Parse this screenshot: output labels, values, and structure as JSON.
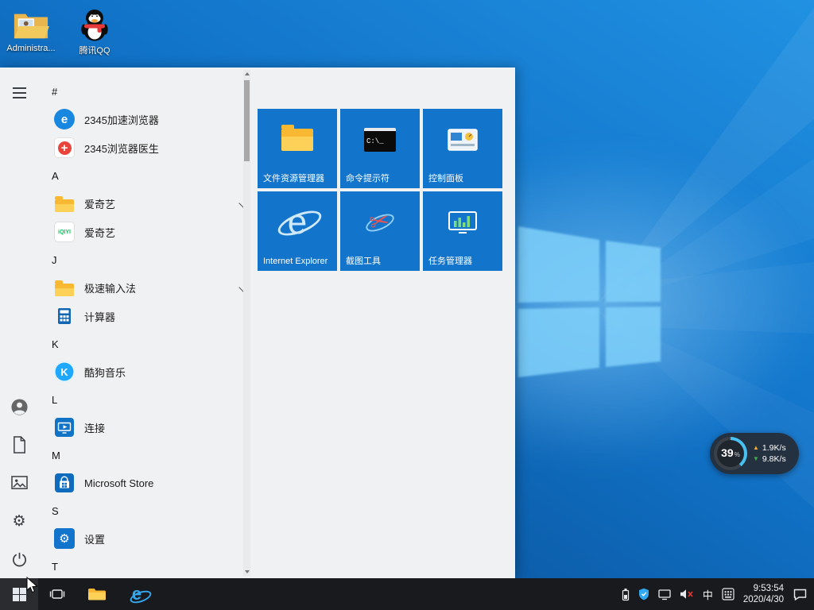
{
  "desktop": {
    "icons": [
      {
        "label": "Administra...",
        "icon": "administrator-folder"
      },
      {
        "label": "腾讯QQ",
        "icon": "tencent-qq"
      }
    ]
  },
  "start_menu": {
    "app_list": [
      {
        "type": "header",
        "label": "#"
      },
      {
        "type": "app",
        "label": "2345加速浏览器",
        "icon": "2345-browser"
      },
      {
        "type": "app",
        "label": "2345浏览器医生",
        "icon": "2345-browser-doctor"
      },
      {
        "type": "header",
        "label": "A"
      },
      {
        "type": "folder",
        "label": "爱奇艺",
        "icon": "folder"
      },
      {
        "type": "app",
        "label": "爱奇艺",
        "icon": "iqiyi"
      },
      {
        "type": "header",
        "label": "J"
      },
      {
        "type": "folder",
        "label": "极速输入法",
        "icon": "folder"
      },
      {
        "type": "app",
        "label": "计算器",
        "icon": "calculator"
      },
      {
        "type": "header",
        "label": "K"
      },
      {
        "type": "app",
        "label": "酷狗音乐",
        "icon": "kugou-music"
      },
      {
        "type": "header",
        "label": "L"
      },
      {
        "type": "app",
        "label": "连接",
        "icon": "connect"
      },
      {
        "type": "header",
        "label": "M"
      },
      {
        "type": "app",
        "label": "Microsoft Store",
        "icon": "microsoft-store"
      },
      {
        "type": "header",
        "label": "S"
      },
      {
        "type": "app",
        "label": "设置",
        "icon": "settings"
      },
      {
        "type": "header",
        "label": "T"
      }
    ],
    "tiles": [
      {
        "label": "文件资源管理器",
        "icon": "file-explorer"
      },
      {
        "label": "命令提示符",
        "icon": "command-prompt"
      },
      {
        "label": "控制面板",
        "icon": "control-panel"
      },
      {
        "label": "Internet Explorer",
        "icon": "internet-explorer"
      },
      {
        "label": "截图工具",
        "icon": "snipping-tool"
      },
      {
        "label": "任务管理器",
        "icon": "task-manager"
      }
    ],
    "cmd_icon_text": "C:\\_"
  },
  "net_widget": {
    "percent": "39",
    "unit": "%",
    "up_speed": "1.9K/s",
    "down_speed": "9.8K/s"
  },
  "taskbar": {
    "ime_indicator": "中",
    "clock": {
      "time": "9:53:54",
      "date": "2020/4/30"
    }
  },
  "colors": {
    "tile_blue": "#1374cc",
    "taskbar_bg": "#191a1d",
    "menu_bg": "#f0f1f2",
    "accent": "#0078d7",
    "ring": "#49c1f0",
    "net_up": "#f0a830",
    "net_down": "#3fae49"
  }
}
